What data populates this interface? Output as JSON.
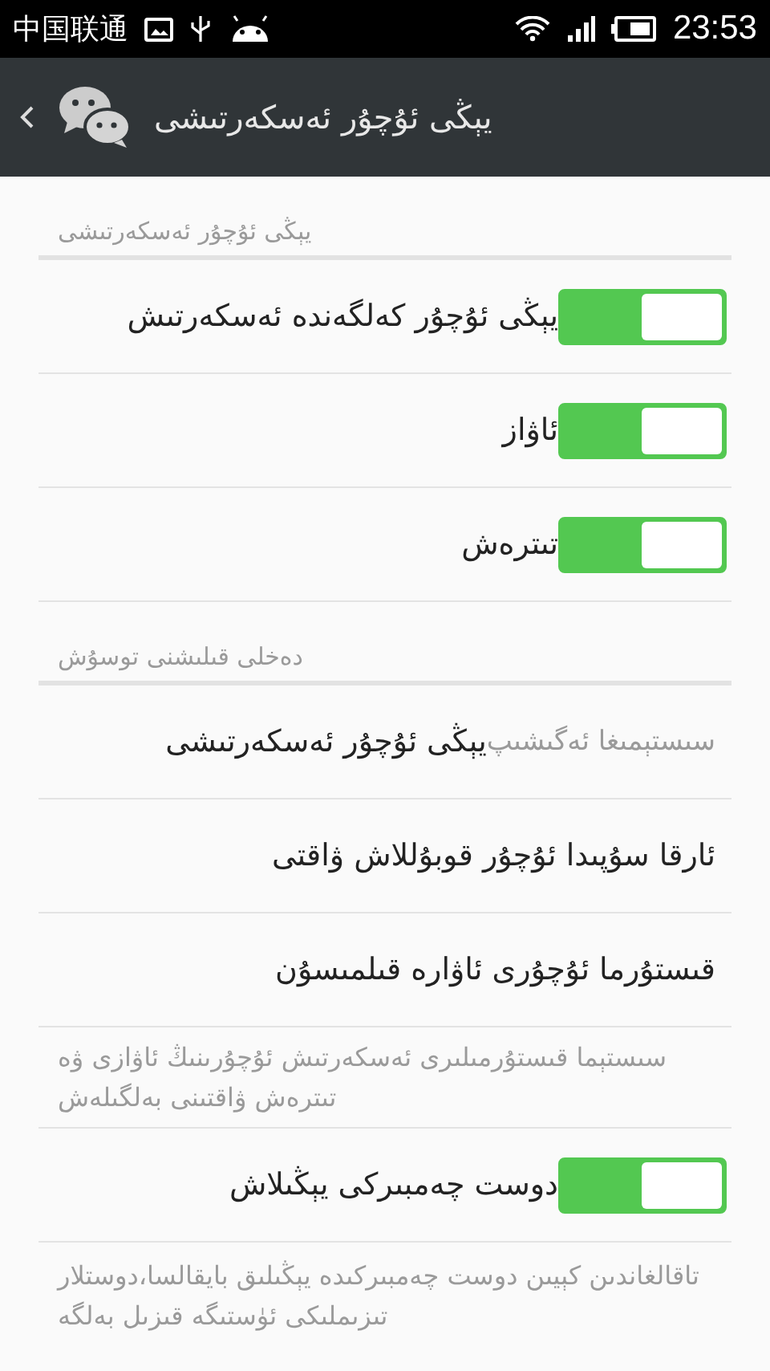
{
  "status_bar": {
    "carrier": "中国联通",
    "time": "23:53"
  },
  "header": {
    "title": "يېڭى ئۇچۇر ئەسكەرتىشى"
  },
  "sections": [
    {
      "title": "يېڭى ئۇچۇر ئەسكەرتىشى",
      "items": [
        {
          "kind": "toggle",
          "label": "يېڭى ئۇچۇر كەلگەندە ئەسكەرتىش",
          "on": true
        },
        {
          "kind": "toggle",
          "label": "ئاۋاز",
          "on": true
        },
        {
          "kind": "toggle",
          "label": "تىترەش",
          "on": true
        }
      ]
    },
    {
      "title": "دەخلى قىلىشنى توسۇش",
      "items": [
        {
          "kind": "link",
          "hint": "سىستېمىغا ئەگىشىپ",
          "label": "يېڭى ئۇچۇر ئەسكەرتىشى"
        },
        {
          "kind": "link",
          "label": "ئارقا سۇپىدا ئۇچۇر قوبۇللاش ۋاقتى"
        },
        {
          "kind": "link",
          "label": "قىستۇرما ئۇچۇرى ئاۋارە قىلمىسۇن"
        },
        {
          "kind": "note",
          "text": "سىستېما قىستۇرمىلىرى ئەسكەرتىش ئۇچۇرىنىڭ ئاۋازى ۋە تىترەش ۋاقتىنى بەلگىلەش"
        },
        {
          "kind": "toggle",
          "label": "دوست چەمبىركى يېڭىلاش",
          "on": true
        },
        {
          "kind": "note",
          "text": "تاقالغاندىن كېيىن دوست چەمبىركىدە يېڭىلىق بايقالسا،دوستلار تىزىملىكى ئۈستىگە قىزىل بەلگە"
        }
      ]
    }
  ]
}
